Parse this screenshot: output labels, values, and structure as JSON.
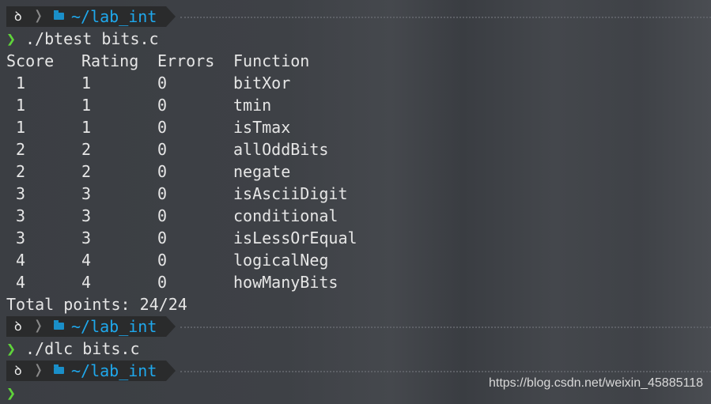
{
  "prompt": {
    "os_icon": "ubuntu-icon",
    "folder_icon": "folder-icon",
    "path": "~/lab_int",
    "symbol": "❯"
  },
  "commands": [
    "./btest bits.c",
    "./dlc bits.c"
  ],
  "table": {
    "headers": [
      "Score",
      "Rating",
      "Errors",
      "Function"
    ],
    "rows": [
      [
        " 1",
        "1",
        "0",
        "bitXor"
      ],
      [
        " 1",
        "1",
        "0",
        "tmin"
      ],
      [
        " 1",
        "1",
        "0",
        "isTmax"
      ],
      [
        " 2",
        "2",
        "0",
        "allOddBits"
      ],
      [
        " 2",
        "2",
        "0",
        "negate"
      ],
      [
        " 3",
        "3",
        "0",
        "isAsciiDigit"
      ],
      [
        " 3",
        "3",
        "0",
        "conditional"
      ],
      [
        " 3",
        "3",
        "0",
        "isLessOrEqual"
      ],
      [
        " 4",
        "4",
        "0",
        "logicalNeg"
      ],
      [
        " 4",
        "4",
        "0",
        "howManyBits"
      ]
    ]
  },
  "total": "Total points: 24/24",
  "watermark": "https://blog.csdn.net/weixin_45885118",
  "colors": {
    "path": "#1fa8ec",
    "prompt_symbol": "#5fd43a",
    "segment_bg": "#2a2b2c"
  }
}
